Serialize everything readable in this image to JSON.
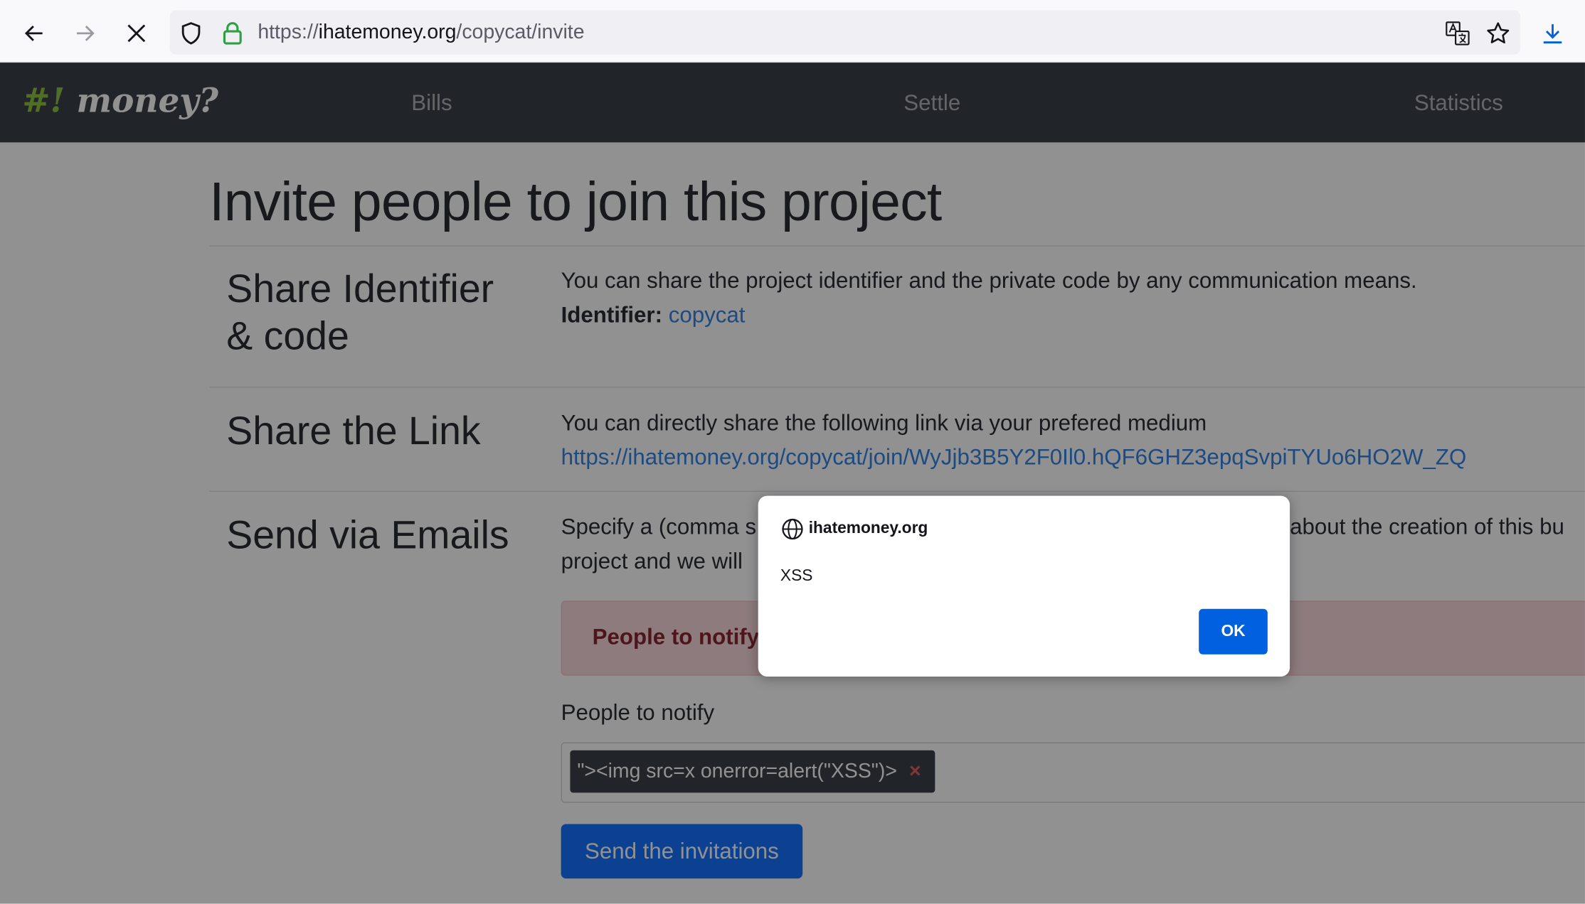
{
  "browser": {
    "url_scheme": "https://",
    "url_host": "ihatemoney.org",
    "url_path": "/copycat/invite"
  },
  "navbar": {
    "logo_mark": "#!",
    "logo_text": "money?",
    "links": [
      "Bills",
      "Settle",
      "Statistics"
    ]
  },
  "page": {
    "title": "Invite people to join this project",
    "sections": {
      "identifier": {
        "title_line1": "Share Identifier",
        "title_line2": "& code",
        "text": "You can share the project identifier and the private code by any communication means.",
        "identifier_label": "Identifier:",
        "identifier_value": "copycat"
      },
      "link": {
        "title": "Share the Link",
        "text": "You can directly share the following link via your prefered medium",
        "url": "https://ihatemoney.org/copycat/join/WyJjb3B5Y2F0Il0.hQF6GHZ3epqSvpiTYUo6HO2W_ZQ"
      },
      "emails": {
        "title": "Send via Emails",
        "text_line1_part1": "Specify a (comma s",
        "text_line1_part2": "about the creation of this bu",
        "text_line2": "project and we will",
        "alert_text": "People to notify",
        "field_label": "People to notify",
        "tag_value": "\"><img src=x onerror=alert(\"XSS\")>",
        "tag_remove": "×",
        "submit_label": "Send the invitations"
      }
    }
  },
  "dialog": {
    "origin": "ihatemoney.org",
    "message": "XSS",
    "ok_label": "OK"
  },
  "colors": {
    "navbar_bg": "#343a40",
    "logo_accent": "#8bbf3c",
    "link": "#2a7fe0",
    "primary_button": "#0d6efd",
    "dialog_ok": "#0061e0",
    "alert_bg": "#f8d7da",
    "alert_text": "#842029"
  }
}
